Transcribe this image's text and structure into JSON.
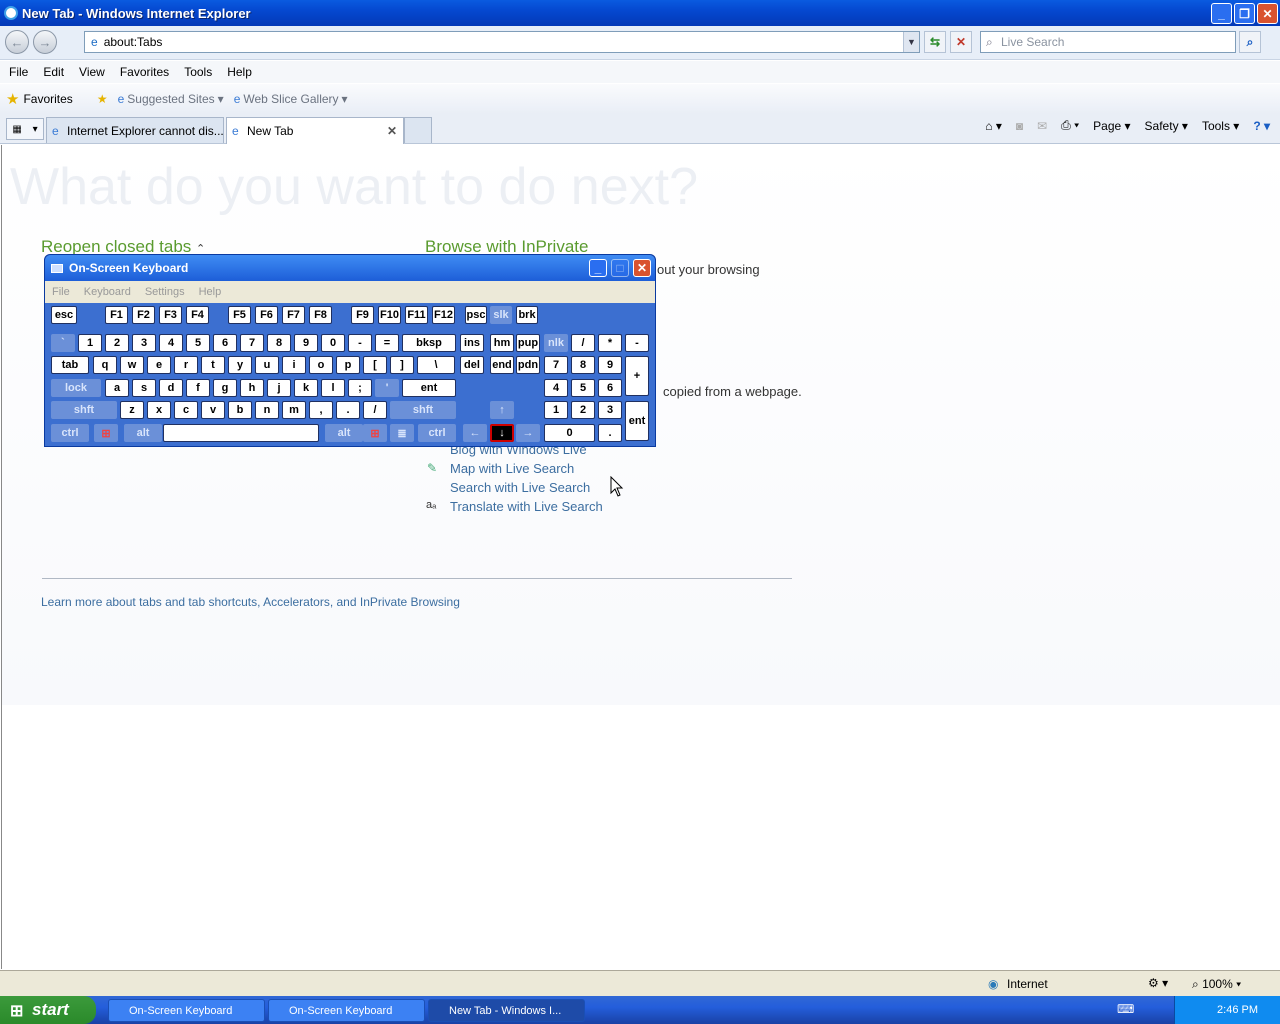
{
  "window": {
    "title": "New Tab - Windows Internet Explorer"
  },
  "nav": {
    "address": "about:Tabs",
    "search_placeholder": "Live Search"
  },
  "menu": [
    "File",
    "Edit",
    "View",
    "Favorites",
    "Tools",
    "Help"
  ],
  "favbar": {
    "favorites": "Favorites",
    "suggested": "Suggested Sites",
    "webslice": "Web Slice Gallery"
  },
  "tabs": [
    {
      "label": "Internet Explorer cannot dis..."
    },
    {
      "label": "New Tab"
    }
  ],
  "cmdbar": {
    "page": "Page",
    "safety": "Safety",
    "tools": "Tools"
  },
  "content": {
    "ghost_heading": "What do you want to do next?",
    "reopen": "Reopen closed tabs",
    "browse": "Browse with InPrivate",
    "browse_desc_fragment": "out your browsing",
    "copied_fragment": "copied from a webpage.",
    "blog": "Blog with Windows Live",
    "map": "Map with Live Search",
    "search": "Search with Live Search",
    "translate": "Translate with Live Search",
    "learn_more": "Learn more about tabs and tab shortcuts, Accelerators, and InPrivate Browsing"
  },
  "osk": {
    "title": "On-Screen Keyboard",
    "menu": [
      "File",
      "Keyboard",
      "Settings",
      "Help"
    ]
  },
  "keys": {
    "r0": [
      "esc",
      "F1",
      "F2",
      "F3",
      "F4",
      "F5",
      "F6",
      "F7",
      "F8",
      "F9",
      "F10",
      "F11",
      "F12",
      "psc",
      "slk",
      "brk"
    ],
    "r1": [
      "`",
      "1",
      "2",
      "3",
      "4",
      "5",
      "6",
      "7",
      "8",
      "9",
      "0",
      "-",
      "=",
      "bksp",
      "ins",
      "hm",
      "pup",
      "nlk",
      "/",
      "*",
      "-"
    ],
    "r2": [
      "tab",
      "q",
      "w",
      "e",
      "r",
      "t",
      "y",
      "u",
      "i",
      "o",
      "p",
      "[",
      "]",
      "\\",
      "del",
      "end",
      "pdn",
      "7",
      "8",
      "9",
      "+"
    ],
    "r3": [
      "lock",
      "a",
      "s",
      "d",
      "f",
      "g",
      "h",
      "j",
      "k",
      "l",
      ";",
      "'",
      "ent",
      "4",
      "5",
      "6"
    ],
    "r4": [
      "shft",
      "z",
      "x",
      "c",
      "v",
      "b",
      "n",
      "m",
      ",",
      ".",
      "/",
      "shft",
      "↑",
      "1",
      "2",
      "3"
    ],
    "r5": [
      "ctrl",
      "alt",
      "alt",
      "ctrl",
      "←",
      "↓",
      "→",
      "0",
      ".",
      "ent"
    ]
  },
  "status": {
    "zone": "Internet",
    "zoom": "100%"
  },
  "taskbar": {
    "start": "start",
    "items": [
      "On-Screen Keyboard",
      "On-Screen Keyboard",
      "New Tab - Windows I..."
    ],
    "clock": "2:46 PM"
  }
}
